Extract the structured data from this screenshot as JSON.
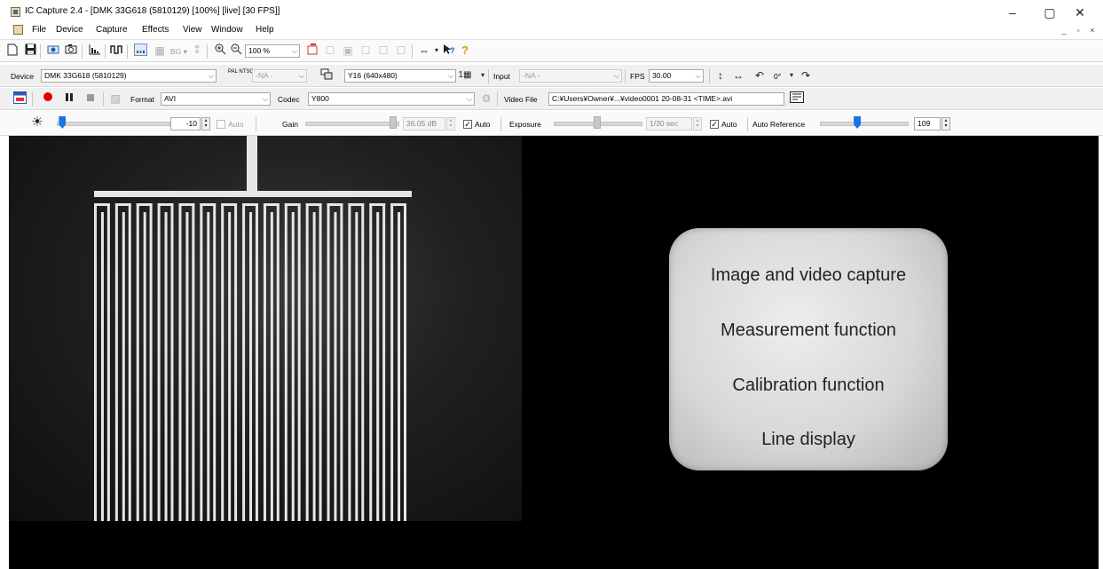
{
  "window": {
    "title": "IC Capture 2.4 - [DMK 33G618 (5810129) [100%] [live]  [30 FPS]]",
    "controls": [
      "–",
      "▢",
      "✕"
    ],
    "mdi_controls": [
      "_",
      "▫",
      "×"
    ]
  },
  "menu": {
    "items": [
      "File",
      "Device",
      "Capture",
      "Effects",
      "View",
      "Window",
      "Help"
    ]
  },
  "toolbar_main": {
    "bg_label": "BG ▾",
    "zoom_value": "100 %"
  },
  "device_bar": {
    "device_label": "Device",
    "device_value": "DMK 33G618 (5810129)",
    "video_norm_label": "PAL NTSC",
    "video_norm_value": "-NA -",
    "video_format_value": "Y16 (640x480)",
    "input_label": "Input",
    "input_value": "-NA -",
    "fps_label": "FPS",
    "fps_value": "30.00",
    "rotation_value": "0°"
  },
  "capture_bar": {
    "format_label": "Format",
    "format_value": "AVI",
    "codec_label": "Codec",
    "codec_value": "Y800",
    "video_file_label": "Video File",
    "video_file_value": "C:¥Users¥Owner¥...¥video0001 20-08-31 <TIME>.avi"
  },
  "properties_bar": {
    "brightness_value": "-10",
    "brightness_level": 0.05,
    "brightness_auto_label": "Auto",
    "gain_label": "Gain",
    "gain_value": "36.05 dB",
    "gain_level": 0.95,
    "gain_auto_label": "Auto",
    "exposure_label": "Exposure",
    "exposure_value": "1/30 sec",
    "exposure_level": 0.5,
    "exposure_auto_label": "Auto",
    "auto_reference_label": "Auto Reference",
    "auto_reference_value": "109",
    "auto_reference_level": 0.43
  },
  "features": [
    "Image and video capture",
    "Measurement function",
    "Calibration function",
    "Line display"
  ],
  "colors": {
    "accent_blue": "#1a73e8",
    "record_red": "#e00000",
    "viewport_bg": "#000000",
    "comb_pattern": "#e6e6e6"
  }
}
